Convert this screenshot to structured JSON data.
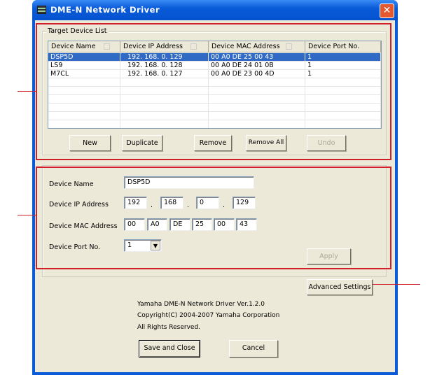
{
  "window": {
    "title": "DME-N Network Driver",
    "close_icon": "close-icon"
  },
  "device_list": {
    "group_label": "Target Device List",
    "columns": [
      "Device Name",
      "Device IP Address",
      "Device MAC Address",
      "Device Port No."
    ],
    "rows": [
      {
        "name": "DSP5D",
        "ip": "192. 168.  0. 129",
        "mac": "00 A0 DE 25 00 43",
        "port": "1",
        "selected": true
      },
      {
        "name": "LS9",
        "ip": "192. 168.  0. 128",
        "mac": "00 A0 DE 24 01 0B",
        "port": "1",
        "selected": false
      },
      {
        "name": "M7CL",
        "ip": "192. 168.  0. 127",
        "mac": "00 A0 DE 23 00 4D",
        "port": "1",
        "selected": false
      }
    ],
    "buttons": {
      "new": "New",
      "duplicate": "Duplicate",
      "remove": "Remove",
      "remove_all": "Remove All",
      "undo": "Undo"
    }
  },
  "editor": {
    "name_label": "Device Name",
    "name_value": "DSP5D",
    "ip_label": "Device IP Address",
    "ip": [
      "192",
      "168",
      "0",
      "129"
    ],
    "mac_label": "Device MAC Address",
    "mac": [
      "00",
      "A0",
      "DE",
      "25",
      "00",
      "43"
    ],
    "port_label": "Device Port No.",
    "port_value": "1",
    "apply": "Apply"
  },
  "advanced": "Advanced Settings",
  "about": [
    "Yamaha DME-N Network Driver Ver.1.2.0",
    "Copyright(C) 2004-2007 Yamaha Corporation",
    "All Rights Reserved."
  ],
  "footer": {
    "save": "Save and Close",
    "cancel": "Cancel"
  },
  "colors": {
    "highlight": "#D0202A",
    "selection": "#316AC5",
    "titlebar": "#0A5BD8"
  }
}
